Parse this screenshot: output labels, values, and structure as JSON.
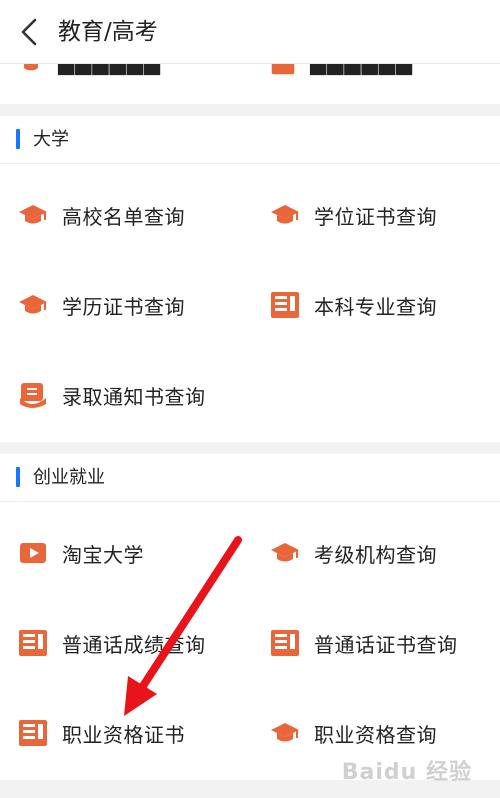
{
  "header": {
    "back_icon": "chevron-left-icon",
    "title": "教育/高考"
  },
  "partial_row": [
    {
      "icon": "graduation-cap-icon"
    },
    {
      "icon": "document-icon"
    }
  ],
  "sections": [
    {
      "title": "大学",
      "accent": "#1677ff",
      "items": [
        {
          "label": "高校名单查询",
          "icon": "graduation-cap-icon"
        },
        {
          "label": "学位证书查询",
          "icon": "graduation-cap-icon"
        },
        {
          "label": "学历证书查询",
          "icon": "graduation-cap-icon"
        },
        {
          "label": "本科专业查询",
          "icon": "document-icon"
        },
        {
          "label": "录取通知书查询",
          "icon": "admission-letter-icon"
        }
      ]
    },
    {
      "title": "创业就业",
      "accent": "#1677ff",
      "items": [
        {
          "label": "淘宝大学",
          "icon": "video-play-icon"
        },
        {
          "label": "考级机构查询",
          "icon": "graduation-cap-icon"
        },
        {
          "label": "普通话成绩查询",
          "icon": "document-icon"
        },
        {
          "label": "普通话证书查询",
          "icon": "document-icon"
        },
        {
          "label": "职业资格证书",
          "icon": "document-icon"
        },
        {
          "label": "职业资格查询",
          "icon": "graduation-cap-icon"
        }
      ]
    }
  ],
  "colors": {
    "icon_orange": "#e8663a",
    "arrow_red": "#e8141a"
  },
  "watermark": "Baidu 经验"
}
